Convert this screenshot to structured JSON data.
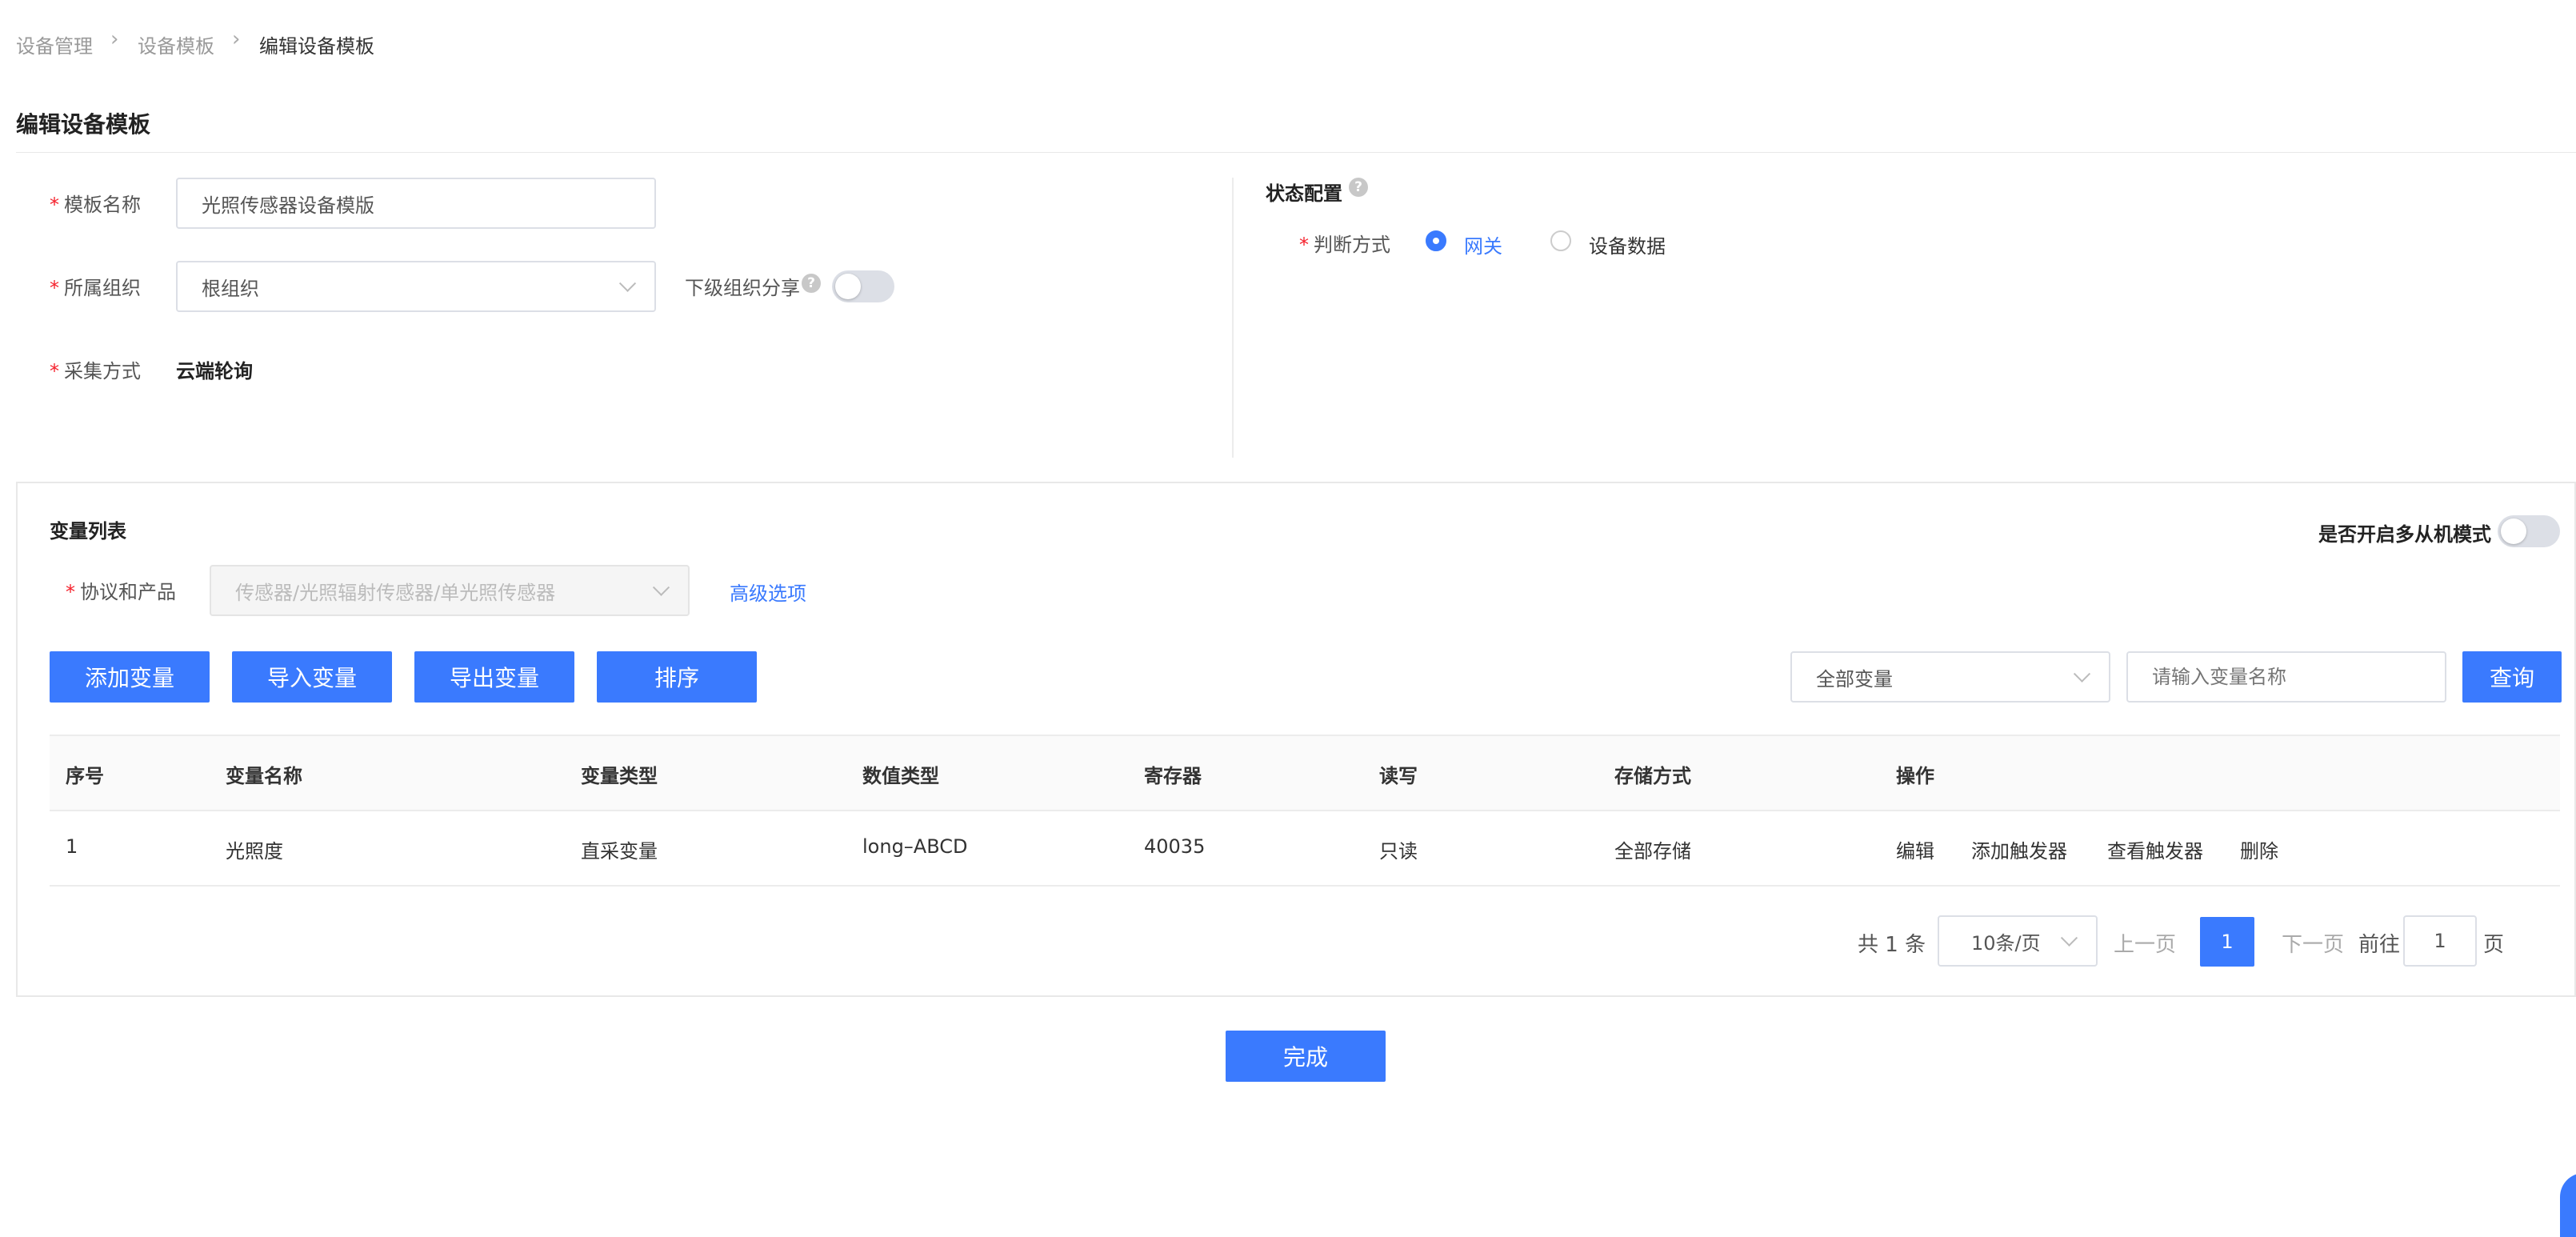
{
  "breadcrumb": [
    "设备管理",
    "设备模板",
    "编辑设备模板"
  ],
  "page_title": "编辑设备模板",
  "form": {
    "template_name_label": "模板名称",
    "template_name_value": "光照传感器设备模版",
    "org_label": "所属组织",
    "org_value": "根组织",
    "share_label": "下级组织分享",
    "collect_label": "采集方式",
    "collect_value": "云端轮询"
  },
  "status_config": {
    "title": "状态配置",
    "judge_label": "判断方式",
    "options": [
      "网关",
      "设备数据"
    ],
    "selected": "网关"
  },
  "variables": {
    "title": "变量列表",
    "multi_slave_label": "是否开启多从机模式",
    "protocol_label": "协议和产品",
    "protocol_value": "传感器/光照辐射传感器/单光照传感器",
    "advanced_link": "高级选项",
    "buttons": [
      "添加变量",
      "导入变量",
      "导出变量",
      "排序"
    ],
    "filter_value": "全部变量",
    "search_placeholder": "请输入变量名称",
    "query_button": "查询",
    "columns": [
      "序号",
      "变量名称",
      "变量类型",
      "数值类型",
      "寄存器",
      "读写",
      "存储方式",
      "操作"
    ],
    "rows": [
      {
        "index": "1",
        "name": "光照度",
        "var_type": "直采变量",
        "value_type": "long–ABCD",
        "register": "40035",
        "rw": "只读",
        "storage": "全部存储"
      }
    ],
    "actions": [
      "编辑",
      "添加触发器",
      "查看触发器",
      "删除"
    ]
  },
  "pagination": {
    "total": "共 1 条",
    "page_size": "10条/页",
    "prev": "上一页",
    "current": "1",
    "next": "下一页",
    "goto": "前往",
    "goto_value": "1",
    "page_unit": "页"
  },
  "finish_button": "完成",
  "colors": {
    "primary": "#3a7afe",
    "required": "#f5222d"
  }
}
